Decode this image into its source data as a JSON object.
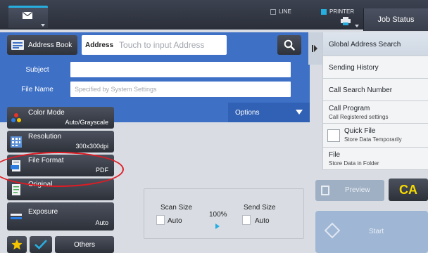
{
  "topbar": {
    "indicators": [
      {
        "label": "LINE",
        "active": false
      },
      {
        "label": "PRINTER",
        "active": true
      }
    ],
    "job_status_label": "Job Status",
    "accent_color": "#27aee0"
  },
  "address": {
    "book_label": "Address Book",
    "field_label": "Address",
    "field_placeholder": "Touch to input Address"
  },
  "form": {
    "subject_label": "Subject",
    "subject_value": "",
    "filename_label": "File Name",
    "filename_placeholder": "Specified by System Settings",
    "options_label": "Options"
  },
  "side_menu": {
    "items": [
      {
        "title": "Global Address Search",
        "sub": ""
      },
      {
        "title": "Sending History",
        "sub": ""
      },
      {
        "title": "Call Search Number",
        "sub": ""
      },
      {
        "title": "Call Program",
        "sub": "Call Registered settings"
      },
      {
        "title": "Quick File",
        "sub": "Store Data Temporarily"
      },
      {
        "title": "File",
        "sub": "Store Data in Folder"
      }
    ]
  },
  "settings": [
    {
      "name": "Color Mode",
      "value": "Auto/Grayscale",
      "icon": "color-mode-icon"
    },
    {
      "name": "Resolution",
      "value": "300x300dpi",
      "icon": "resolution-icon"
    },
    {
      "name": "File Format",
      "value": "PDF",
      "icon": "file-format-icon"
    },
    {
      "name": "Original",
      "value": "",
      "icon": "original-icon"
    },
    {
      "name": "Exposure",
      "value": "Auto",
      "icon": "exposure-icon"
    }
  ],
  "bottom_bar": {
    "others_label": "Others"
  },
  "size": {
    "scan_label": "Scan Size",
    "scan_value": "Auto",
    "ratio": "100%",
    "send_label": "Send Size",
    "send_value": "Auto"
  },
  "actions": {
    "preview_label": "Preview",
    "ca_label": "CA",
    "start_label": "Start"
  },
  "colors": {
    "form_blue": "#3e70c6",
    "annotation_red": "#e01b23",
    "ca_yellow": "#f5d900"
  }
}
